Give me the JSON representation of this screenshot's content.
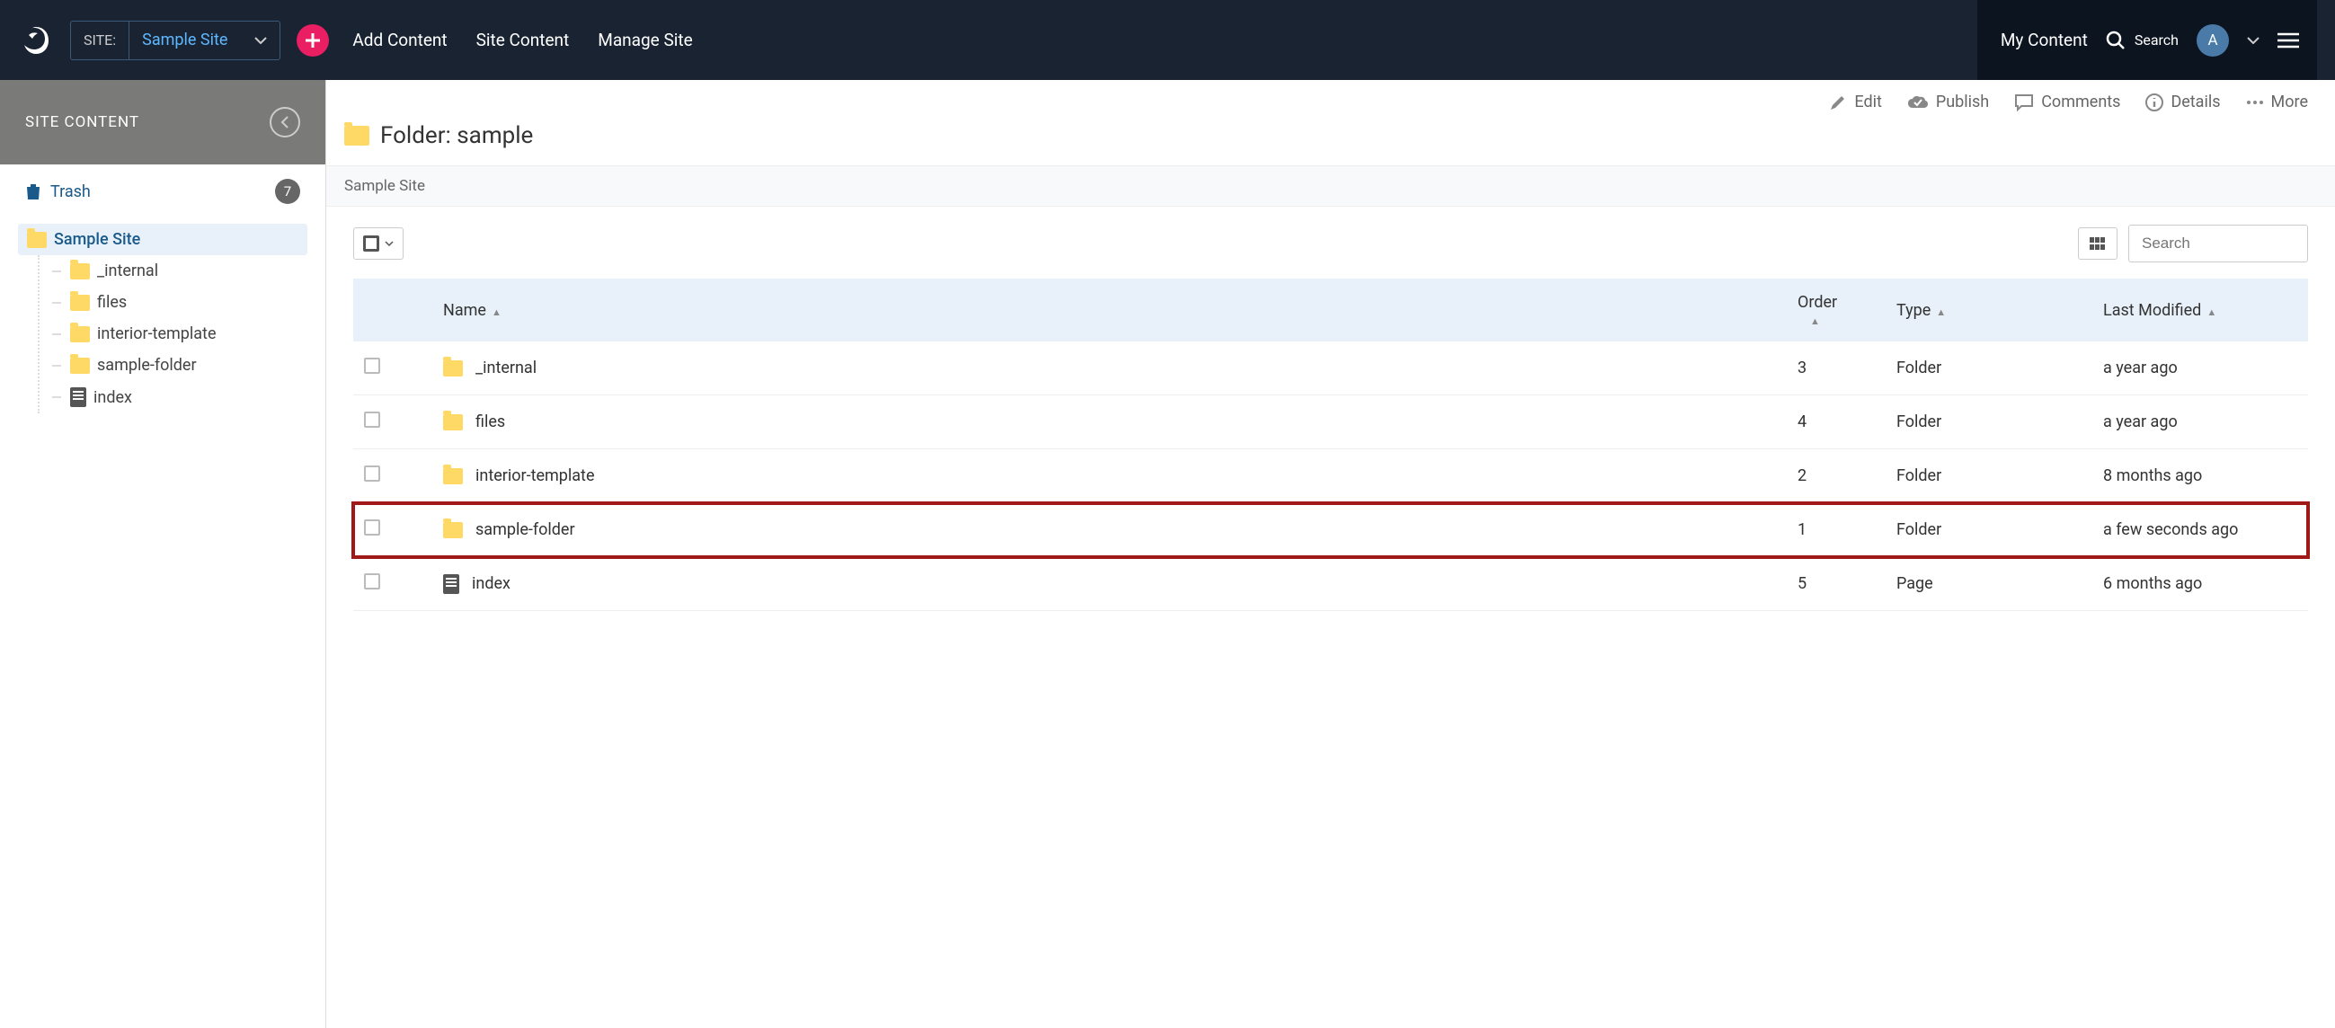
{
  "topbar": {
    "site_label": "SITE:",
    "site_name": "Sample Site",
    "add_content": "Add Content",
    "nav": [
      "Site Content",
      "Manage Site"
    ],
    "my_content": "My Content",
    "search": "Search",
    "avatar_letter": "A"
  },
  "sidebar": {
    "title": "SITE CONTENT",
    "trash_label": "Trash",
    "trash_count": "7",
    "root": "Sample Site",
    "children": [
      {
        "name": "_internal",
        "type": "folder"
      },
      {
        "name": "files",
        "type": "folder"
      },
      {
        "name": "interior-template",
        "type": "folder"
      },
      {
        "name": "sample-folder",
        "type": "folder"
      },
      {
        "name": "index",
        "type": "page"
      }
    ]
  },
  "toolbar": {
    "edit": "Edit",
    "publish": "Publish",
    "comments": "Comments",
    "details": "Details",
    "more": "More"
  },
  "page": {
    "title": "Folder: sample",
    "breadcrumb": "Sample Site"
  },
  "table": {
    "search_placeholder": "Search",
    "headers": {
      "name": "Name",
      "order": "Order",
      "type": "Type",
      "modified": "Last Modified"
    },
    "rows": [
      {
        "name": "_internal",
        "order": "3",
        "type": "Folder",
        "modified": "a year ago",
        "icon": "folder",
        "highlight": false
      },
      {
        "name": "files",
        "order": "4",
        "type": "Folder",
        "modified": "a year ago",
        "icon": "folder",
        "highlight": false
      },
      {
        "name": "interior-template",
        "order": "2",
        "type": "Folder",
        "modified": "8 months ago",
        "icon": "folder",
        "highlight": false
      },
      {
        "name": "sample-folder",
        "order": "1",
        "type": "Folder",
        "modified": "a few seconds ago",
        "icon": "folder",
        "highlight": true
      },
      {
        "name": "index",
        "order": "5",
        "type": "Page",
        "modified": "6 months ago",
        "icon": "page",
        "highlight": false
      }
    ]
  }
}
